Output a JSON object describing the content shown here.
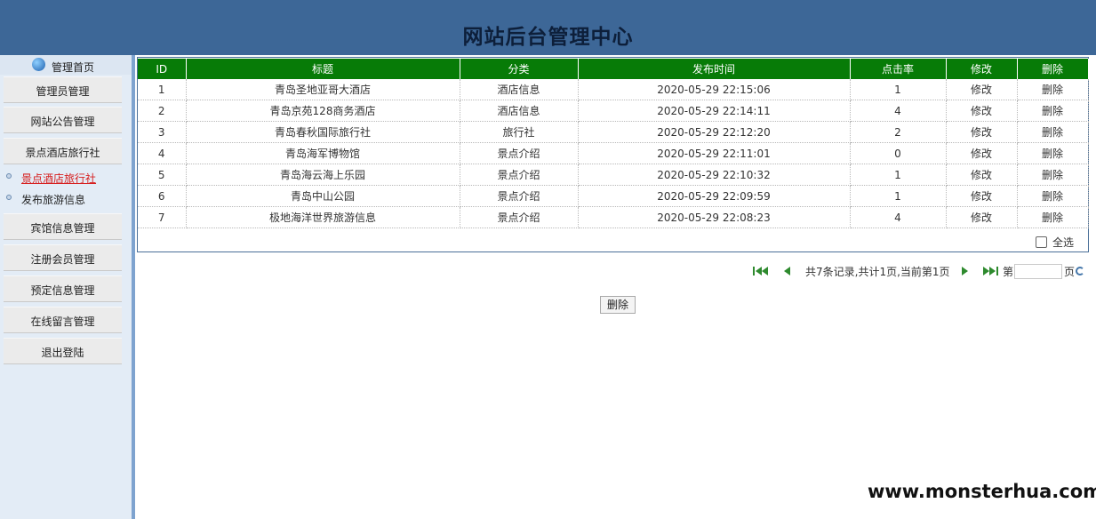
{
  "header": {
    "title": "网站后台管理中心"
  },
  "sidebar": {
    "home_label": "管理首页",
    "items": [
      {
        "label": "管理员管理"
      },
      {
        "label": "网站公告管理"
      },
      {
        "label": "景点酒店旅行社"
      },
      {
        "label": "宾馆信息管理"
      },
      {
        "label": "注册会员管理"
      },
      {
        "label": "预定信息管理"
      },
      {
        "label": "在线留言管理"
      },
      {
        "label": "退出登陆"
      }
    ],
    "subitems": [
      {
        "label": "景点酒店旅行社",
        "active": true
      },
      {
        "label": "发布旅游信息",
        "active": false
      }
    ]
  },
  "table": {
    "columns": [
      "ID",
      "标题",
      "分类",
      "发布时间",
      "点击率",
      "修改",
      "删除"
    ],
    "rows": [
      {
        "id": "1",
        "title": "青岛圣地亚哥大酒店",
        "category": "酒店信息",
        "time": "2020-05-29 22:15:06",
        "clicks": "1",
        "edit": "修改",
        "delete": "删除"
      },
      {
        "id": "2",
        "title": "青岛京苑128商务酒店",
        "category": "酒店信息",
        "time": "2020-05-29 22:14:11",
        "clicks": "4",
        "edit": "修改",
        "delete": "删除"
      },
      {
        "id": "3",
        "title": "青岛春秋国际旅行社",
        "category": "旅行社",
        "time": "2020-05-29 22:12:20",
        "clicks": "2",
        "edit": "修改",
        "delete": "删除"
      },
      {
        "id": "4",
        "title": "青岛海军博物馆",
        "category": "景点介绍",
        "time": "2020-05-29 22:11:01",
        "clicks": "0",
        "edit": "修改",
        "delete": "删除"
      },
      {
        "id": "5",
        "title": "青岛海云海上乐园",
        "category": "景点介绍",
        "time": "2020-05-29 22:10:32",
        "clicks": "1",
        "edit": "修改",
        "delete": "删除"
      },
      {
        "id": "6",
        "title": "青岛中山公园",
        "category": "景点介绍",
        "time": "2020-05-29 22:09:59",
        "clicks": "1",
        "edit": "修改",
        "delete": "删除"
      },
      {
        "id": "7",
        "title": "极地海洋世界旅游信息",
        "category": "景点介绍",
        "time": "2020-05-29 22:08:23",
        "clicks": "4",
        "edit": "修改",
        "delete": "删除"
      }
    ],
    "select_all_label": "全选"
  },
  "pager": {
    "summary": "共7条记录,共计1页,当前第1页",
    "goto_prefix": "第",
    "goto_suffix": "页",
    "page_value": ""
  },
  "actions": {
    "delete_label": "删除"
  },
  "watermark": "www.monsterhua.com",
  "colors": {
    "header_bg": "#3d6797",
    "table_header_bg": "#077b07",
    "sidebar_bg": "#e3ecf6",
    "active_link": "#d62020"
  },
  "icons": [
    "globe-icon",
    "first-page-icon",
    "prev-page-icon",
    "next-page-icon",
    "last-page-icon",
    "refresh-icon"
  ]
}
